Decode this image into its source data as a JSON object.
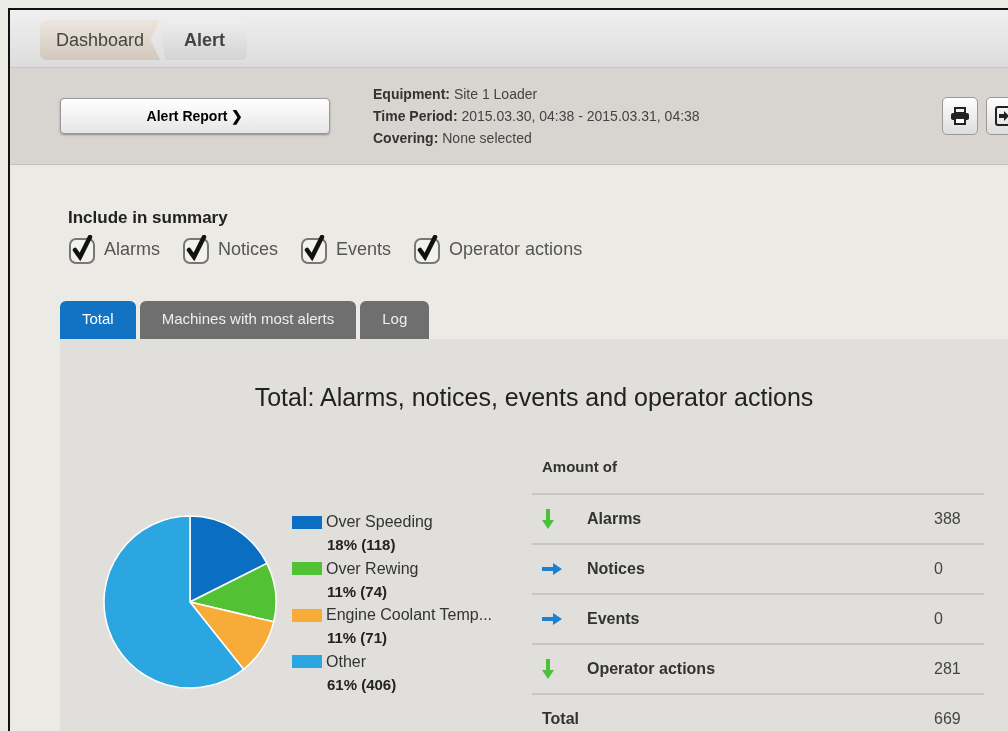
{
  "breadcrumb": [
    {
      "label": "Dashboard",
      "selected": false
    },
    {
      "label": "Alert",
      "selected": true
    }
  ],
  "report_button": {
    "label": "Alert Report ❯"
  },
  "info": [
    {
      "label": "Equipment:",
      "value": "Site 1 Loader"
    },
    {
      "label": "Time Period:",
      "value": "2015.03.30, 04:38 - 2015.03.31, 04:38"
    },
    {
      "label": "Covering:",
      "value": "None selected"
    }
  ],
  "summary": {
    "heading": "Include in summary",
    "options": [
      {
        "label": "Alarms",
        "checked": true
      },
      {
        "label": "Notices",
        "checked": true
      },
      {
        "label": "Events",
        "checked": true
      },
      {
        "label": "Operator actions",
        "checked": true
      }
    ]
  },
  "tabs": [
    {
      "label": "Total",
      "selected": true
    },
    {
      "label": "Machines with most alerts",
      "selected": false
    },
    {
      "label": "Log",
      "selected": false
    }
  ],
  "panel_title": "Total: Alarms, notices, events and operator actions",
  "chart_data": {
    "type": "pie",
    "categories": [
      "Over Speeding",
      "Over Rewing",
      "Engine Coolant Temp...",
      "Other"
    ],
    "values": [
      17.6,
      11.1,
      10.6,
      60.7
    ]
  },
  "legend": [
    {
      "value_text": "18% (118)",
      "color": "#0a6fc2"
    },
    {
      "value_text": "11% (74)",
      "color": "#52c234"
    },
    {
      "value_text": "11% (71)",
      "color": "#f7ac3a"
    },
    {
      "value_text": "61% (406)",
      "color": "#2ba6e1"
    }
  ],
  "amounts": {
    "heading": "Amount of",
    "rows": [
      {
        "kind": "down",
        "label": "Alarms",
        "value": "388"
      },
      {
        "kind": "flat",
        "label": "Notices",
        "value": "0"
      },
      {
        "kind": "flat",
        "label": "Events",
        "value": "0"
      },
      {
        "kind": "down",
        "label": "Operator actions",
        "value": "281"
      }
    ],
    "total_label": "Total",
    "total_value": "669"
  }
}
